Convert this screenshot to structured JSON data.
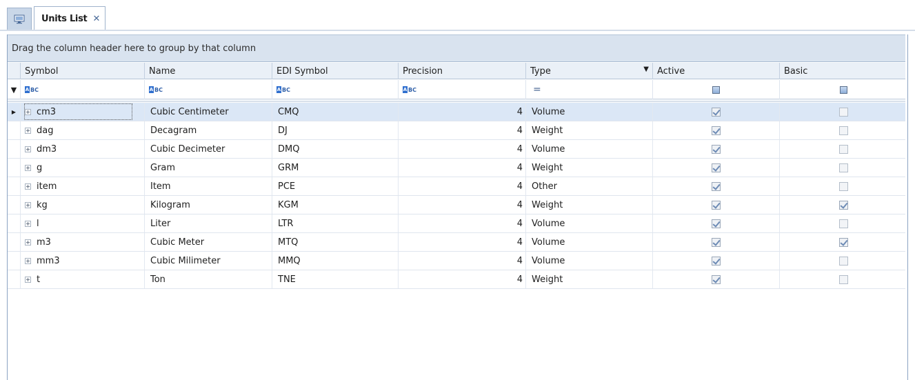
{
  "window": {
    "tab_label": "Units List",
    "home_tab_icon": "monitor-icon",
    "close_glyph": "✕"
  },
  "grid": {
    "group_panel_text": "Drag the column header here to group by that column",
    "columns": [
      {
        "key": "symbol",
        "label": "Symbol"
      },
      {
        "key": "name",
        "label": "Name"
      },
      {
        "key": "edi",
        "label": "EDI Symbol"
      },
      {
        "key": "precision",
        "label": "Precision"
      },
      {
        "key": "type",
        "label": "Type"
      },
      {
        "key": "active",
        "label": "Active"
      },
      {
        "key": "basic",
        "label": "Basic"
      }
    ],
    "filter_row": {
      "symbol": "abc-icon",
      "name": "abc-icon",
      "edi": "abc-icon",
      "precision": "abc-icon",
      "type": "equals-icon",
      "active": "checkbox-filter",
      "basic": "checkbox-filter"
    },
    "selected_row_index": 0,
    "rows": [
      {
        "symbol": "cm3",
        "name": "Cubic Centimeter",
        "edi": "CMQ",
        "precision": "4",
        "type": "Volume",
        "active": true,
        "basic": false
      },
      {
        "symbol": "dag",
        "name": "Decagram",
        "edi": "DJ",
        "precision": "4",
        "type": "Weight",
        "active": true,
        "basic": false
      },
      {
        "symbol": "dm3",
        "name": "Cubic Decimeter",
        "edi": "DMQ",
        "precision": "4",
        "type": "Volume",
        "active": true,
        "basic": false
      },
      {
        "symbol": "g",
        "name": "Gram",
        "edi": "GRM",
        "precision": "4",
        "type": "Weight",
        "active": true,
        "basic": false
      },
      {
        "symbol": "item",
        "name": "Item",
        "edi": "PCE",
        "precision": "4",
        "type": "Other",
        "active": true,
        "basic": false
      },
      {
        "symbol": "kg",
        "name": "Kilogram",
        "edi": "KGM",
        "precision": "4",
        "type": "Weight",
        "active": true,
        "basic": true
      },
      {
        "symbol": "l",
        "name": "Liter",
        "edi": "LTR",
        "precision": "4",
        "type": "Volume",
        "active": true,
        "basic": false
      },
      {
        "symbol": "m3",
        "name": "Cubic Meter",
        "edi": "MTQ",
        "precision": "4",
        "type": "Volume",
        "active": true,
        "basic": true
      },
      {
        "symbol": "mm3",
        "name": "Cubic Milimeter",
        "edi": "MMQ",
        "precision": "4",
        "type": "Volume",
        "active": true,
        "basic": false
      },
      {
        "symbol": "t",
        "name": "Ton",
        "edi": "TNE",
        "precision": "4",
        "type": "Weight",
        "active": true,
        "basic": false
      }
    ]
  }
}
